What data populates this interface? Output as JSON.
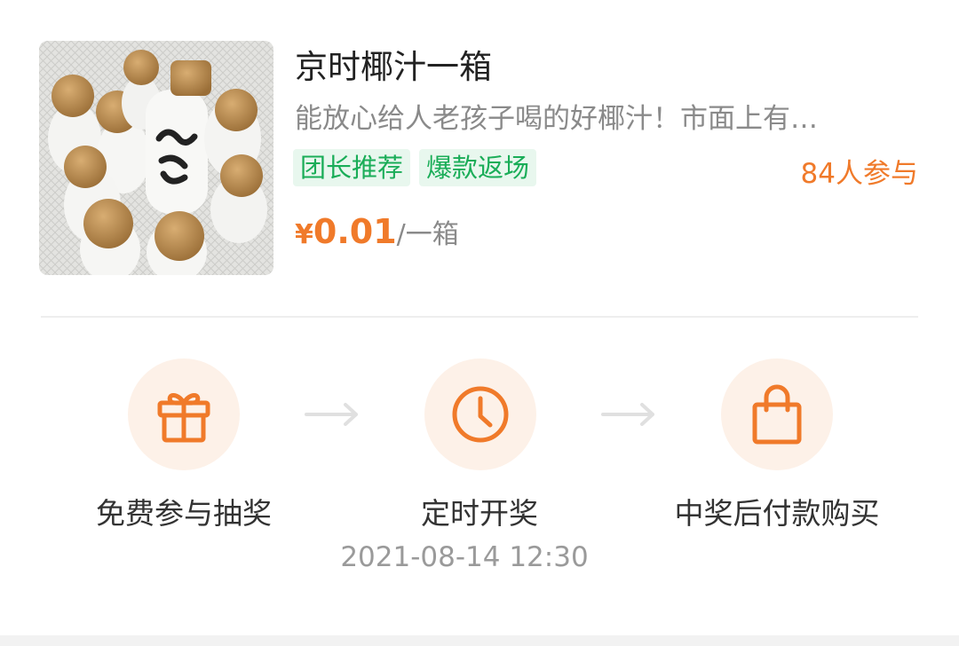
{
  "product": {
    "title": "京时椰汁一箱",
    "description": "能放心给人老孩子喝的好椰汁！市面上有…",
    "tags": [
      "团长推荐",
      "爆款返场"
    ],
    "participants": "84人参与",
    "price": {
      "symbol": "¥",
      "value": "0.01",
      "unit": "/一箱"
    },
    "image_icon": "coconut-milk-bottles-photo"
  },
  "steps": [
    {
      "icon": "gift-icon",
      "label": "免费参与抽奖"
    },
    {
      "icon": "clock-icon",
      "label": "定时开奖",
      "time": "2021-08-14 12:30"
    },
    {
      "icon": "shopping-bag-icon",
      "label": "中奖后付款购买"
    }
  ],
  "colors": {
    "accent_orange": "#f07a2a",
    "tag_green": "#1aad58",
    "tag_bg": "#e8f7ee",
    "step_circle_bg": "#fdf1e8",
    "arrow_gray": "#e0e0e0"
  }
}
